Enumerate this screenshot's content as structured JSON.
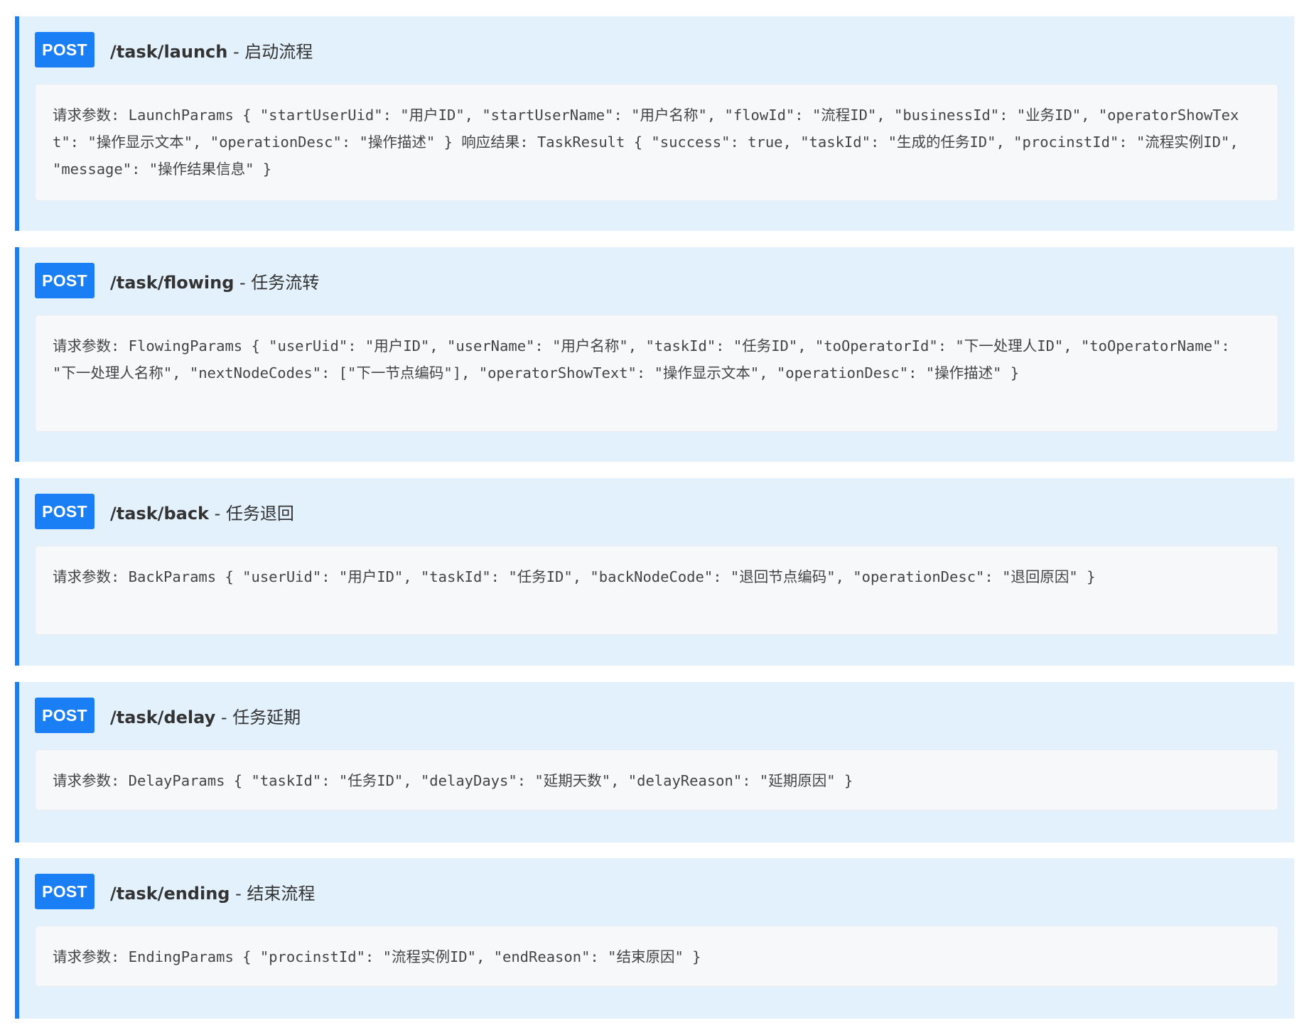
{
  "endpoints": [
    {
      "method": "POST",
      "path": "/task/launch",
      "desc": " - 启动流程",
      "body": "请求参数: LaunchParams { \"startUserUid\": \"用户ID\", \"startUserName\": \"用户名称\", \"flowId\": \"流程ID\", \"businessId\": \"业务ID\", \"operatorShowText\": \"操作显示文本\", \"operationDesc\": \"操作描述\" } 响应结果: TaskResult { \"success\": true, \"taskId\": \"生成的任务ID\", \"procinstId\": \"流程实例ID\", \"message\": \"操作结果信息\" }"
    },
    {
      "method": "POST",
      "path": "/task/flowing",
      "desc": " - 任务流转",
      "body": "请求参数: FlowingParams { \"userUid\": \"用户ID\", \"userName\": \"用户名称\", \"taskId\": \"任务ID\", \"toOperatorId\": \"下一处理人ID\", \"toOperatorName\": \"下一处理人名称\", \"nextNodeCodes\": [\"下一节点编码\"], \"operatorShowText\": \"操作显示文本\", \"operationDesc\": \"操作描述\" }"
    },
    {
      "method": "POST",
      "path": "/task/back",
      "desc": " - 任务退回",
      "body": "请求参数: BackParams { \"userUid\": \"用户ID\", \"taskId\": \"任务ID\", \"backNodeCode\": \"退回节点编码\", \"operationDesc\": \"退回原因\" }"
    },
    {
      "method": "POST",
      "path": "/task/delay",
      "desc": " - 任务延期",
      "body": "请求参数: DelayParams { \"taskId\": \"任务ID\", \"delayDays\": \"延期天数\", \"delayReason\": \"延期原因\" }"
    },
    {
      "method": "POST",
      "path": "/task/ending",
      "desc": " - 结束流程",
      "body": "请求参数: EndingParams { \"procinstId\": \"流程实例ID\", \"endReason\": \"结束原因\" }"
    }
  ],
  "colors": {
    "accent": "#1a7ff5",
    "card_background": "#e3f1fc",
    "code_background": "#f6f8fa"
  }
}
